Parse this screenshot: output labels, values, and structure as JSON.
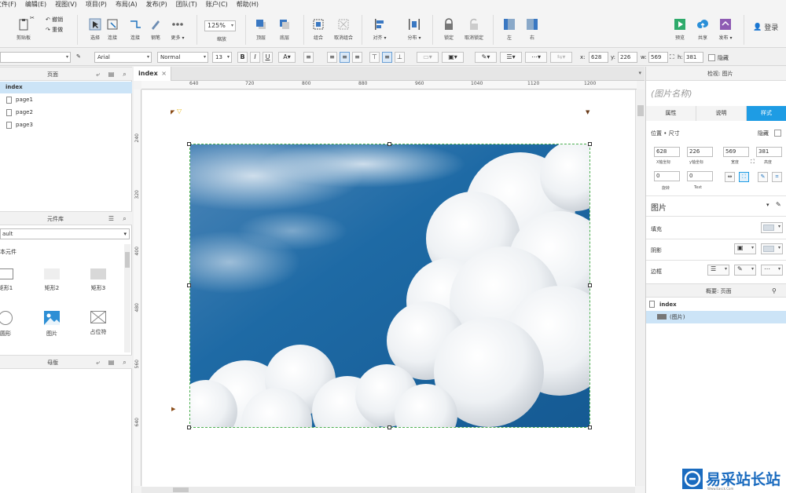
{
  "menubar": {
    "items": [
      "文件(F)",
      "编辑(E)",
      "视图(V)",
      "项目(P)",
      "布局(A)",
      "发布(P)",
      "团队(T)",
      "账户(C)",
      "帮助(H)"
    ]
  },
  "toolbar": {
    "clipboard_label": "剪贴板",
    "cut_label": "剪切",
    "undo_label": "撤销",
    "redo_label": "重做",
    "select_label": "选择",
    "connect_label": "连接",
    "pen_label": "钢笔",
    "more_label": "更多",
    "zoom_value": "125%",
    "zoom_label": "缩放",
    "top_label": "顶层",
    "bottom_label": "底层",
    "group_label": "组合",
    "ungroup_label": "取消组合",
    "align_label": "对齐",
    "distribute_label": "分布",
    "lock_label": "锁定",
    "unlock_label": "取消锁定",
    "left_label": "左",
    "right_label": "右",
    "preview_label": "预览",
    "share_label": "共享",
    "publish_label": "发布",
    "login_label": "登录"
  },
  "formatbar": {
    "font_family": "Arial",
    "font_style": "Normal",
    "font_size": "13",
    "x_label": "x:",
    "x_value": "628",
    "y_label": "y:",
    "y_value": "226",
    "w_label": "w:",
    "w_value": "569",
    "h_label": "h:",
    "h_value": "381",
    "hidden_label": "隐藏"
  },
  "left_panel": {
    "pages_title": "页面",
    "pages": [
      "index",
      "page1",
      "page2",
      "page3"
    ],
    "library_title": "元件库",
    "library_select": "ault",
    "library_section": "本元件",
    "widgets": [
      "矩形1",
      "矩形2",
      "矩形3",
      "圆形",
      "图片",
      "占位符"
    ],
    "masters_title": "母版"
  },
  "canvas": {
    "tab_label": "index",
    "ruler_top_ticks": [
      "640",
      "720",
      "800",
      "880",
      "960",
      "1040",
      "1120",
      "1200"
    ],
    "ruler_left_ticks": [
      "240",
      "320",
      "400",
      "480",
      "560",
      "640"
    ]
  },
  "right_panel": {
    "inspector_title": "检视: 图片",
    "image_name_placeholder": "(图片名称)",
    "tabs": [
      "属性",
      "说明",
      "样式"
    ],
    "position_size_label": "位置 • 尺寸",
    "hidden_label": "隐藏",
    "x_value": "628",
    "x_caption": "X轴坐标",
    "y_value": "226",
    "y_caption": "y轴坐标",
    "w_value": "569",
    "w_caption": "宽度",
    "h_value": "381",
    "h_caption": "高度",
    "rotate_value": "0",
    "rotate_caption": "旋转",
    "text_rotate_value": "0",
    "text_rotate_caption": "Text",
    "style_name": "图片",
    "fill_label": "填充",
    "shadow_label": "阴影",
    "border_label": "边框",
    "outline_title": "概要: 页面",
    "outline_page": "index",
    "outline_item": "(图片)"
  },
  "watermark": {
    "text": "易采站长站",
    "sub": "Www.Easck.Com"
  },
  "colors": {
    "accent": "#1e9ce4",
    "selection": "#cce4f7",
    "selection_border": "#4caf50",
    "sky": "#1d6aa3"
  }
}
